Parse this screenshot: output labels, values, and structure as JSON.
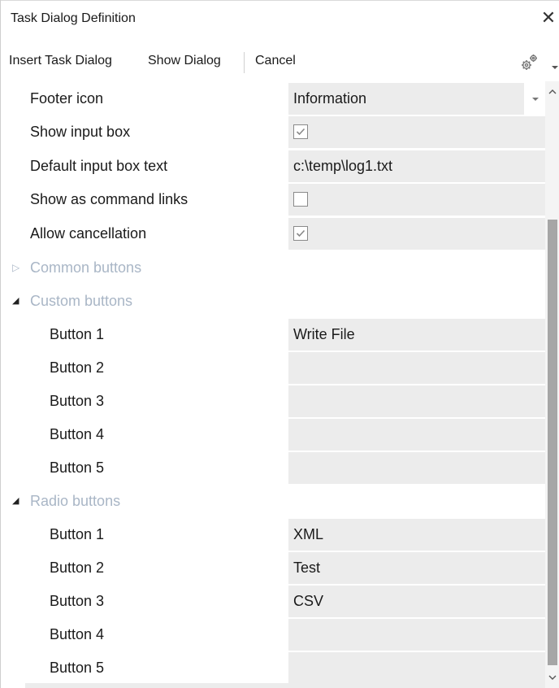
{
  "window": {
    "title": "Task Dialog Definition",
    "close_glyph": "✕"
  },
  "toolbar": {
    "insert_label": "Insert Task Dialog",
    "show_label": "Show Dialog",
    "cancel_label": "Cancel"
  },
  "properties": {
    "footer_icon": {
      "label": "Footer icon",
      "value": "Information"
    },
    "show_input_box": {
      "label": "Show input box",
      "checked": true
    },
    "default_input_text": {
      "label": "Default input box text",
      "value": "c:\\temp\\log1.txt"
    },
    "command_links": {
      "label": "Show as command links",
      "checked": false
    },
    "allow_cancellation": {
      "label": "Allow cancellation",
      "checked": true
    }
  },
  "groups": {
    "common": {
      "label": "Common buttons",
      "expanded": false
    },
    "custom": {
      "label": "Custom buttons",
      "expanded": true,
      "items": [
        {
          "label": "Button 1",
          "value": "Write File"
        },
        {
          "label": "Button 2",
          "value": ""
        },
        {
          "label": "Button 3",
          "value": ""
        },
        {
          "label": "Button 4",
          "value": ""
        },
        {
          "label": "Button 5",
          "value": ""
        }
      ]
    },
    "radio": {
      "label": "Radio buttons",
      "expanded": true,
      "items": [
        {
          "label": "Button 1",
          "value": "XML"
        },
        {
          "label": "Button 2",
          "value": "Test"
        },
        {
          "label": "Button 3",
          "value": "CSV"
        },
        {
          "label": "Button 4",
          "value": ""
        },
        {
          "label": "Button 5",
          "value": ""
        }
      ]
    }
  },
  "icons": {
    "settings": "gear-icon",
    "overflow": "chevron-down-icon",
    "dropdown": "chevron-down-icon",
    "collapsed": "triangle-right-icon",
    "expanded": "triangle-down-icon",
    "scroll_up": "chevron-up-icon",
    "scroll_down": "chevron-down-icon"
  },
  "colors": {
    "value_background": "#ececec",
    "group_label": "#a9b6c6",
    "scroll_thumb": "#a6a6a6"
  }
}
